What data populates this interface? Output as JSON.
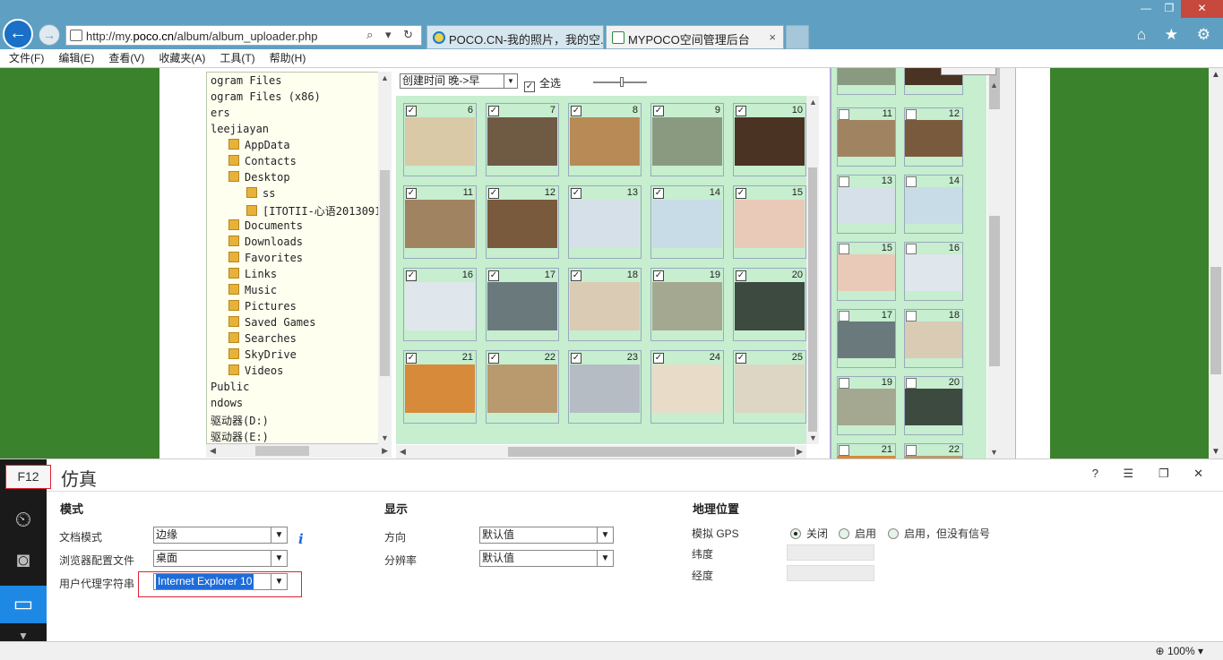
{
  "browser": {
    "url_prefix": "http://my.",
    "url_domain": "poco.cn",
    "url_path": "/album/album_uploader.php",
    "address_tools": "⌕ ▾ ↻",
    "tabs": [
      {
        "label": "POCO.CN-我的照片，我的空..."
      },
      {
        "label": "MYPOCO空间管理后台",
        "close": "×"
      }
    ],
    "window_controls": {
      "minimize": "—",
      "restore": "❐",
      "close": "✕"
    },
    "right_icons": "⌂ ★ ⚙",
    "back_glyph": "←",
    "forward_glyph": "→"
  },
  "menu": [
    "文件(F)",
    "编辑(E)",
    "查看(V)",
    "收藏夹(A)",
    "工具(T)",
    "帮助(H)"
  ],
  "tree": {
    "rows": [
      {
        "label": "ogram Files",
        "indent": 0,
        "folder": false
      },
      {
        "label": "ogram Files (x86)",
        "indent": 0,
        "folder": false
      },
      {
        "label": "ers",
        "indent": 0,
        "folder": false
      },
      {
        "label": " leejiayan",
        "indent": 0,
        "folder": false
      },
      {
        "label": "AppData",
        "indent": 1,
        "folder": true
      },
      {
        "label": "Contacts",
        "indent": 1,
        "folder": true
      },
      {
        "label": "Desktop",
        "indent": 1,
        "folder": true
      },
      {
        "label": "ss",
        "indent": 2,
        "folder": true
      },
      {
        "label": "[ITOTII-心语20130913]",
        "indent": 2,
        "folder": true
      },
      {
        "label": "Documents",
        "indent": 1,
        "folder": true
      },
      {
        "label": "Downloads",
        "indent": 1,
        "folder": true
      },
      {
        "label": "Favorites",
        "indent": 1,
        "folder": true
      },
      {
        "label": "Links",
        "indent": 1,
        "folder": true
      },
      {
        "label": "Music",
        "indent": 1,
        "folder": true
      },
      {
        "label": "Pictures",
        "indent": 1,
        "folder": true
      },
      {
        "label": "Saved Games",
        "indent": 1,
        "folder": true
      },
      {
        "label": "Searches",
        "indent": 1,
        "folder": true
      },
      {
        "label": "SkyDrive",
        "indent": 1,
        "folder": true
      },
      {
        "label": "Videos",
        "indent": 1,
        "folder": true
      },
      {
        "label": " Public",
        "indent": 0,
        "folder": false
      },
      {
        "label": "ndows",
        "indent": 0,
        "folder": false
      },
      {
        "label": "驱动器(D:)",
        "indent": 0,
        "folder": false
      },
      {
        "label": "驱动器(E:)",
        "indent": 0,
        "folder": false
      }
    ]
  },
  "toolbar": {
    "sort_value": "创建时间 晚->早",
    "select_all_label": "全选",
    "check_glyph": "✓",
    "dropdown_glyph": "▼"
  },
  "photos": {
    "numbers": [
      6,
      7,
      8,
      9,
      10,
      11,
      12,
      13,
      14,
      15,
      16,
      17,
      18,
      19,
      20,
      21,
      22,
      23,
      24,
      25
    ],
    "colors": [
      "#d9c9a6",
      "#6f5a44",
      "#b88a56",
      "#8a9a80",
      "#4a3322",
      "#a08462",
      "#7a5a3c",
      "#d6e0e8",
      "#c8dce8",
      "#e9c9b8",
      "#dfe6ec",
      "#6a7a7c",
      "#d9cbb4",
      "#a4a890",
      "#3c4a40",
      "#d68a3a",
      "#b89a6e",
      "#b6bcc4",
      "#e8dcc8",
      "#ddd6c4"
    ]
  },
  "right_panel": {
    "numbers": [
      11,
      12,
      13,
      14,
      15,
      16,
      17,
      18,
      19,
      20,
      21,
      22
    ],
    "colors": [
      "#a08462",
      "#7a5a3c",
      "#d6e0e8",
      "#c8dce8",
      "#e9c9b8",
      "#dfe6ec",
      "#6a7a7c",
      "#d9cbb4",
      "#a4a890",
      "#3c4a40",
      "#d68a3a",
      "#b89a6e"
    ]
  },
  "devtools": {
    "f12": "F12",
    "title": "仿真",
    "right_icons": "? ☰ ❐ ✕",
    "sections": {
      "mode": "模式",
      "display": "显示",
      "geo": "地理位置"
    },
    "fields": {
      "doc_mode_label": "文档模式",
      "doc_mode_value": "边缘",
      "browser_profile_label": "浏览器配置文件",
      "browser_profile_value": "桌面",
      "ua_label": "用户代理字符串",
      "ua_value": "Internet Explorer 10",
      "orientation_label": "方向",
      "orientation_value": "默认值",
      "resolution_label": "分辨率",
      "resolution_value": "默认值",
      "gps_label": "模拟 GPS",
      "gps_off": "关闭",
      "gps_on": "启用",
      "gps_on_no_signal": "启用，但没有信号",
      "latitude_label": "纬度",
      "longitude_label": "经度"
    },
    "info_glyph": "i"
  },
  "status": {
    "zoom": "100%",
    "zoom_icon": "⊕"
  }
}
